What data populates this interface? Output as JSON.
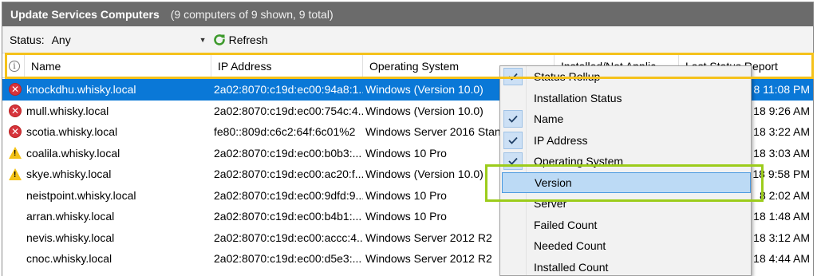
{
  "title_bar": {
    "title": "Update Services Computers",
    "count_text": "(9 computers of 9 shown, 9 total)"
  },
  "toolbar": {
    "status_label": "Status:",
    "status_value": "Any",
    "refresh_label": "Refresh"
  },
  "columns": [
    {
      "label": "Name"
    },
    {
      "label": "IP Address"
    },
    {
      "label": "Operating System"
    },
    {
      "label": "Installed/Not Applic"
    },
    {
      "label": "Last Status Report"
    }
  ],
  "rows": [
    {
      "status": "error",
      "name": "knockdhu.whisky.local",
      "ip": "2a02:8070:c19d:ec00:94a8:1...",
      "os": "Windows (Version 10.0)",
      "report": "8 11:08 PM",
      "selected": true
    },
    {
      "status": "error",
      "name": "mull.whisky.local",
      "ip": "2a02:8070:c19d:ec00:754c:4...",
      "os": "Windows (Version 10.0)",
      "report": "18 9:26 AM"
    },
    {
      "status": "error",
      "name": "scotia.whisky.local",
      "ip": "fe80::809d:c6c2:64f:6c01%2",
      "os": "Windows Server 2016 Stand",
      "report": "18 3:22 AM"
    },
    {
      "status": "warning",
      "name": "coalila.whisky.local",
      "ip": "2a02:8070:c19d:ec00:b0b3:...",
      "os": "Windows 10 Pro",
      "report": "18 3:03 AM"
    },
    {
      "status": "warning",
      "name": "skye.whisky.local",
      "ip": "2a02:8070:c19d:ec00:ac20:f...",
      "os": "Windows (Version 10.0)",
      "report": "18 9:58 PM"
    },
    {
      "status": "none",
      "name": "neistpoint.whisky.local",
      "ip": "2a02:8070:c19d:ec00:9dfd:9...",
      "os": "Windows 10 Pro",
      "report": "8 2:02 AM"
    },
    {
      "status": "none",
      "name": "arran.whisky.local",
      "ip": "2a02:8070:c19d:ec00:b4b1:...",
      "os": "Windows 10 Pro",
      "report": "18 1:48 AM"
    },
    {
      "status": "none",
      "name": "nevis.whisky.local",
      "ip": "2a02:8070:c19d:ec00:accc:4...",
      "os": "Windows Server 2012 R2",
      "report": "18 3:12 AM"
    },
    {
      "status": "none",
      "name": "cnoc.whisky.local",
      "ip": "2a02:8070:c19d:ec00:d5e3:...",
      "os": "Windows Server 2012 R2",
      "report": "18 4:44 AM"
    }
  ],
  "context_menu": {
    "items": [
      {
        "label": "Status Rollup",
        "checked": true
      },
      {
        "label": "Installation Status",
        "checked": false
      },
      {
        "label": "Name",
        "checked": true
      },
      {
        "label": "IP Address",
        "checked": true
      },
      {
        "label": "Operating System",
        "checked": true
      },
      {
        "label": "Version",
        "checked": false,
        "hover": true
      },
      {
        "label": "Server",
        "checked": false
      },
      {
        "label": "Failed Count",
        "checked": false
      },
      {
        "label": "Needed Count",
        "checked": false
      },
      {
        "label": "Installed Count",
        "checked": false
      }
    ]
  },
  "colors": {
    "title_bg": "#6b6b6b",
    "selection": "#0a78d7",
    "highlight_yellow": "#f5c21b",
    "highlight_green": "#9ccc1b",
    "menu_hover": "#bcdaf5"
  },
  "icons": {
    "error": "error-x-icon",
    "warning": "warning-triangle-icon",
    "refresh": "refresh-icon",
    "check": "checkmark-icon",
    "info": "info-icon"
  }
}
